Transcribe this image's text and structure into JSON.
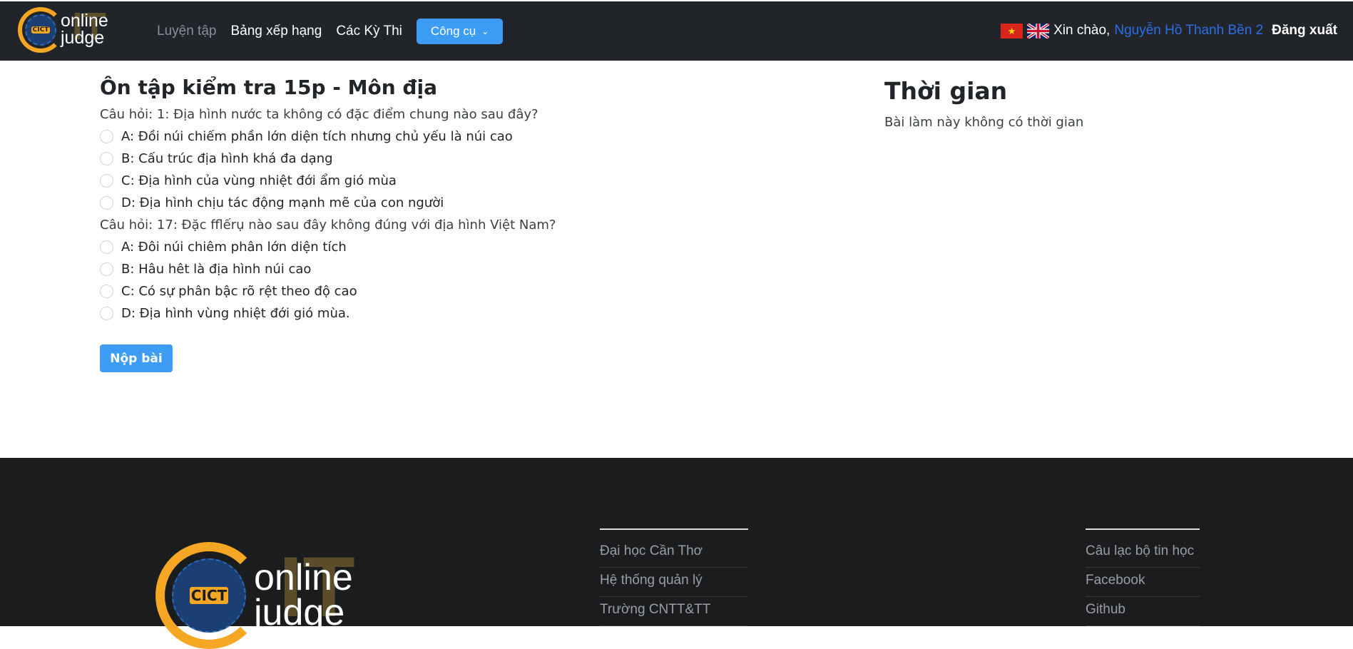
{
  "nav": {
    "logo": {
      "line1": "online",
      "line2": "judge",
      "badge": "CICT",
      "watermark": "IT"
    },
    "links": [
      {
        "label": "Luyện tập",
        "active": false
      },
      {
        "label": "Bảng xếp hạng"
      },
      {
        "label": "Các Kỳ Thi"
      }
    ],
    "tools_label": "Công cụ",
    "greeting": "Xin chào,",
    "user": "Nguyễn Hồ Thanh Bền 2",
    "logout": "Đăng xuất",
    "flags": [
      "vietnam-flag",
      "uk-flag"
    ]
  },
  "quiz": {
    "title": "Ôn tập kiểm tra 15p - Môn địa",
    "questions": [
      {
        "text": "Câu hỏi: 1: Địa hình nước ta không có đặc điểm chung nào sau đây?",
        "options": [
          "A: Đồi núi chiếm phần lớn diện tích nhưng chủ yếu là núi cao",
          "B: Cấu trúc địa hình khá đa dạng",
          "C: Địa hình của vùng nhiệt đới ẩm gió mùa",
          "D: Địa hình chịu tác động mạnh mẽ của con người"
        ]
      },
      {
        "text": "Câu hỏi: 17: Đặc fflếrụ nào sau đây không đúng với địa hình Việt Nam?",
        "options": [
          "A: Đôi núi chiêm phân lớn diện tích",
          "B: Hâu hêt là địa hình núi cao",
          "C: Có sự phân bậc rõ rệt theo độ cao",
          "D: Địa hình vùng nhiệt đới gió mùa."
        ]
      }
    ],
    "submit": "Nộp bài"
  },
  "timer": {
    "title": "Thời gian",
    "text": "Bài làm này không có thời gian"
  },
  "footer": {
    "col1": [
      "Đại học Cần Thơ",
      "Hệ thống quản lý",
      "Trường CNTT&TT"
    ],
    "col2": [
      "Câu lạc bộ tin học",
      "Facebook",
      "Github"
    ]
  },
  "colors": {
    "navbar": "#212529",
    "accent": "#3d9df5",
    "user": "#2d6ee8",
    "footer": "#1b1c1e"
  }
}
